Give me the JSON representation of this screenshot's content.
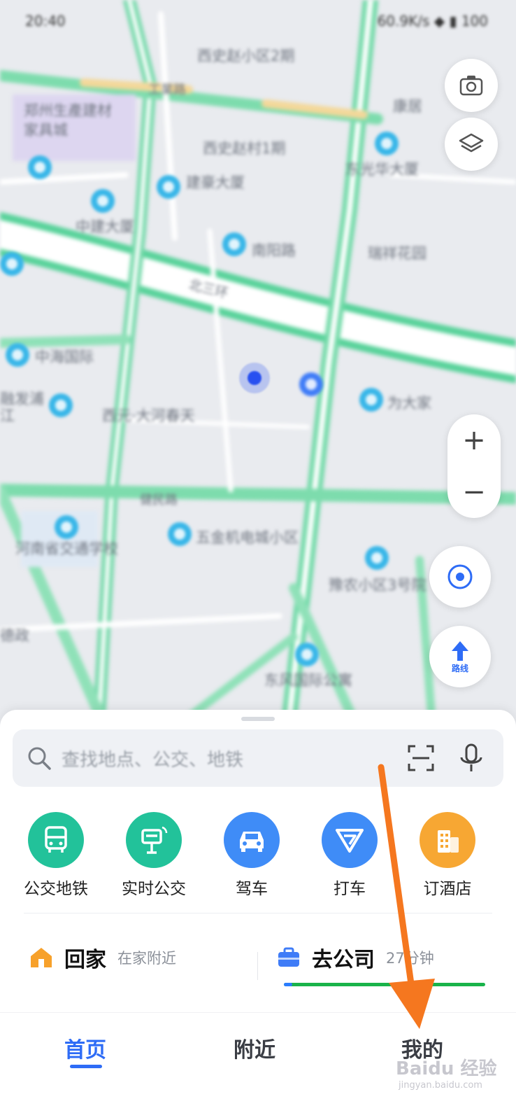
{
  "status_bar": {
    "time": "20:40",
    "right": "60.9K/s ◆ ▮ 100"
  },
  "map": {
    "labels": [
      "西史赵小区2期",
      "郑州生產建材家具城",
      "工業路",
      "西史赵村1期",
      "康居",
      "东光华大厦",
      "建豪大厦",
      "中建大厦",
      "南阳路",
      "瑞祥花园",
      "北三环",
      "中海国际",
      "融发浦江",
      "西元·大河春天",
      "为大家",
      "健民路",
      "五金机电城小区",
      "河南省交通学校",
      "豫农小区3号院",
      "德政",
      "东风国际公寓"
    ],
    "zoom_in": "+",
    "zoom_out": "−",
    "nav_label": "路线"
  },
  "search": {
    "placeholder": "查找地点、公交、地铁"
  },
  "quick_actions": [
    {
      "label": "公交地铁",
      "color": "#22c29a"
    },
    {
      "label": "实时公交",
      "color": "#22c29a"
    },
    {
      "label": "驾车",
      "color": "#3f8cf7"
    },
    {
      "label": "打车",
      "color": "#3f8cf7"
    },
    {
      "label": "订酒店",
      "color": "#f7a733"
    }
  ],
  "shortcuts": {
    "home": {
      "title": "回家",
      "sub": "在家附近"
    },
    "work": {
      "title": "去公司",
      "sub": "27分钟"
    }
  },
  "tabs": [
    "首页",
    "附近",
    "我的"
  ],
  "watermark": {
    "main": "Baidu 经验",
    "sub": "jingyan.baidu.com"
  }
}
